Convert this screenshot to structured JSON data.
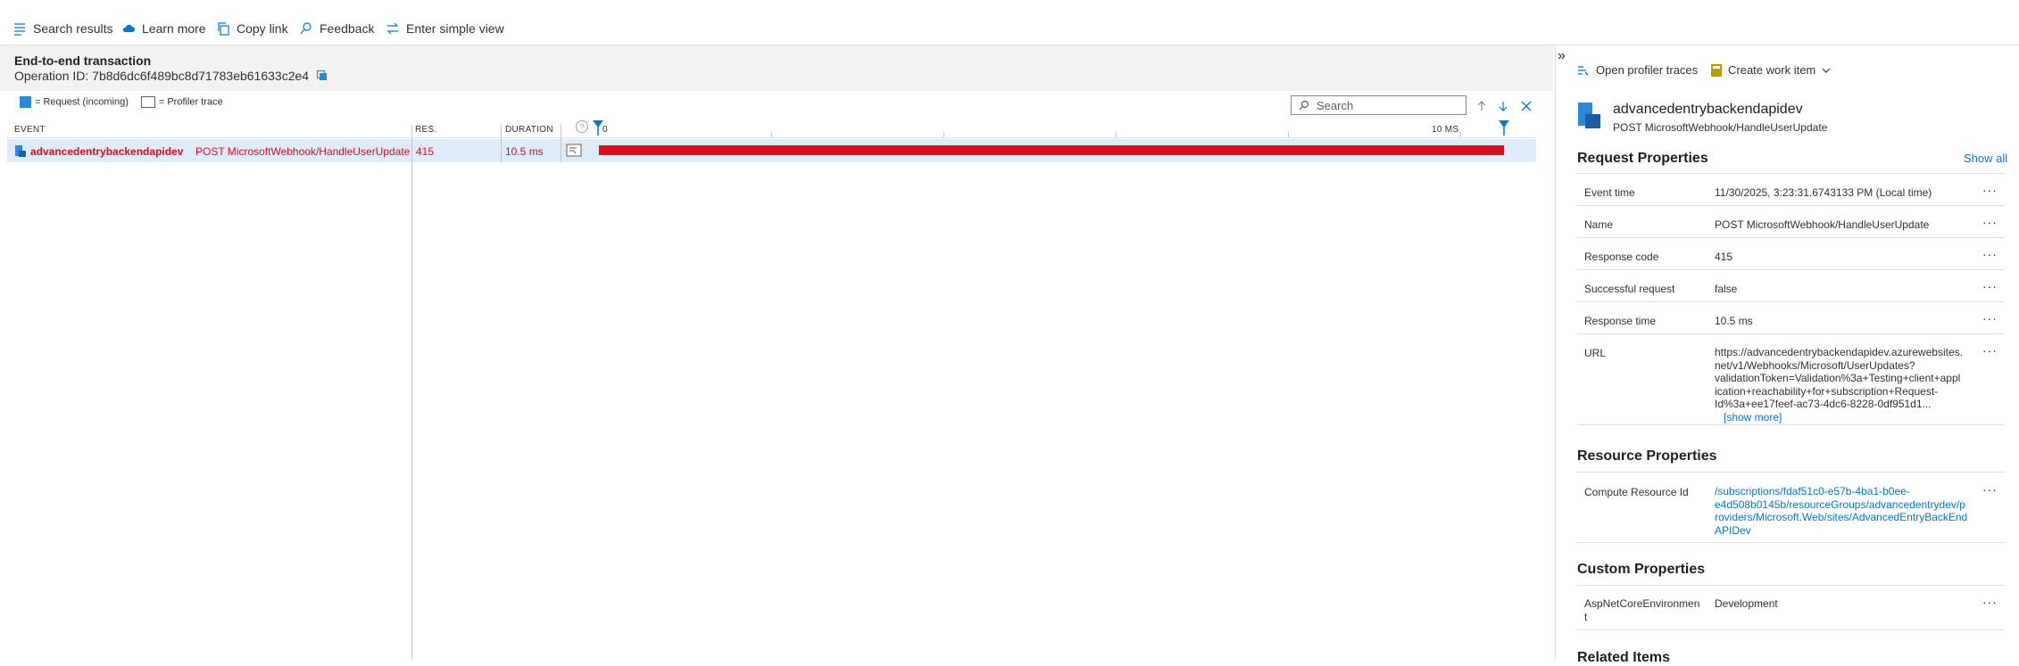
{
  "toolbar": {
    "items": [
      {
        "label": "Search results",
        "icon": "list-icon"
      },
      {
        "label": "Learn more",
        "icon": "cloud-icon"
      },
      {
        "label": "Copy link",
        "icon": "copy-icon"
      },
      {
        "label": "Feedback",
        "icon": "feedback-icon"
      },
      {
        "label": "Enter simple view",
        "icon": "swap-icon"
      }
    ]
  },
  "transaction": {
    "title": "End-to-end transaction",
    "operation_id": "Operation ID: 7b8d6dc6f489bc8d71783eb61633c2e4"
  },
  "legend": {
    "request": "= Request (incoming)",
    "profiler": "= Profiler trace"
  },
  "search": {
    "placeholder": "Search"
  },
  "columns": {
    "event": "EVENT",
    "res": "RES.",
    "duration": "DURATION"
  },
  "timeline": {
    "start": "0",
    "end": "10 MS"
  },
  "event_row": {
    "name": "advancedentrybackendapidev",
    "operation": "POST MicrosoftWebhook/HandleUserUpdate",
    "res": "415",
    "duration": "10.5 ms"
  },
  "details": {
    "expand_glyph": "»",
    "open_profiler": "Open profiler traces",
    "create_work_item": "Create work item",
    "resource_name": "advancedentrybackendapidev",
    "resource_sub": "POST MicrosoftWebhook/HandleUserUpdate",
    "request_props_title": "Request Properties",
    "show_all": "Show all",
    "request_props": [
      {
        "label": "Event time",
        "value": "11/30/2025, 3:23:31.6743133 PM (Local time)"
      },
      {
        "label": "Name",
        "value": "POST MicrosoftWebhook/HandleUserUpdate"
      },
      {
        "label": "Response code",
        "value": "415"
      },
      {
        "label": "Successful request",
        "value": "false"
      },
      {
        "label": "Response time",
        "value": "10.5 ms"
      }
    ],
    "url": {
      "label": "URL",
      "lines": [
        "https://advancedentrybackendapidev.azurewebsites.",
        "net/v1/Webhooks/Microsoft/UserUpdates?",
        "validationToken=Validation%3a+Testing+client+appl",
        "ication+reachability+for+subscription+Request-",
        "Id%3a+ee17feef-ac73-4dc6-8228-0df951d1..."
      ],
      "show_more": "[show more]"
    },
    "resource_props_title": "Resource Properties",
    "compute_resource": {
      "label": "Compute Resource Id",
      "lines": [
        "/subscriptions/fdaf51c0-e57b-4ba1-b0ee-",
        "e4d508b0145b/resourceGroups/advancedentrydev/p",
        "roviders/Microsoft.Web/sites/AdvancedEntryBackEnd",
        "APIDev"
      ]
    },
    "custom_props_title": "Custom Properties",
    "custom_prop": {
      "label_lines": [
        "AspNetCoreEnvironmen",
        "t"
      ],
      "value": "Development"
    },
    "related_title": "Related Items",
    "more_glyph": "···"
  },
  "colors": {
    "error_red": "#e00b1c",
    "accent_blue": "#0078d4",
    "row_highlight": "#deecf9"
  }
}
